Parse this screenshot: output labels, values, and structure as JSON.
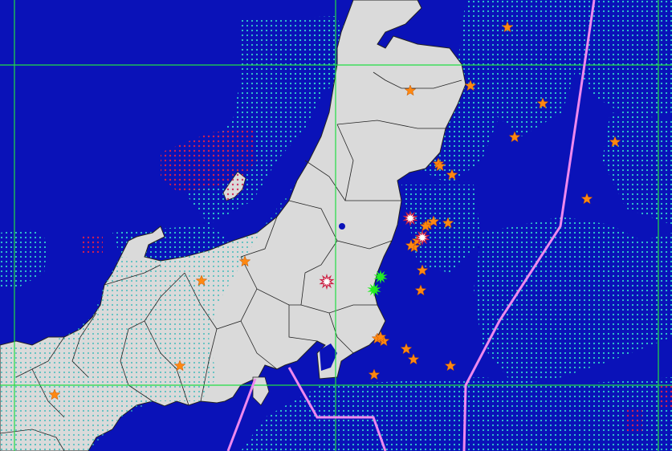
{
  "map": {
    "colors": {
      "sea": "#0a12b8",
      "land": "#dadada",
      "border": "#222222",
      "grid_line": "#22dd44",
      "plate_boundary": "#ee88ee",
      "dots_cyan": "#33cccc",
      "dots_red": "#cc2244",
      "quake_star": "#ff8811",
      "quake_green": "#22ee22",
      "quake_white": "#ffffff"
    },
    "legend": [],
    "markers": {
      "orange_star_count": 30,
      "green_burst_count": 2,
      "white_burst_count": 3
    }
  }
}
